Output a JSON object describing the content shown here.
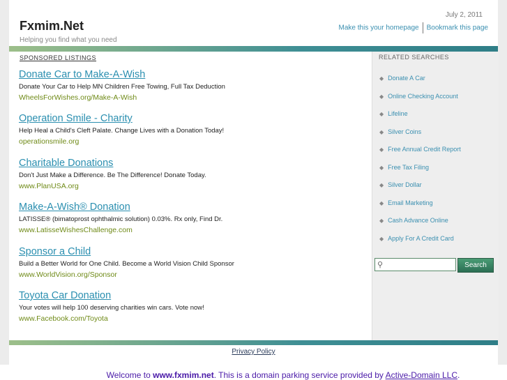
{
  "header": {
    "site_title": "Fxmim.Net",
    "tagline": "Helping you find what you need",
    "date": "July 2, 2011",
    "make_homepage": "Make this your homepage",
    "bookmark": "Bookmark this page"
  },
  "main": {
    "sponsored_label": "SPONSORED LISTINGS",
    "ads": [
      {
        "title": "Donate Car to Make-A-Wish",
        "desc": "Donate Your Car to Help MN Children Free Towing, Full Tax Deduction",
        "url": "WheelsForWishes.org/Make-A-Wish"
      },
      {
        "title": "Operation Smile - Charity",
        "desc": "Help Heal a Child's Cleft Palate. Change Lives with a Donation Today!",
        "url": "operationsmile.org"
      },
      {
        "title": "Charitable Donations",
        "desc": "Don't Just Make a Difference. Be The Difference! Donate Today.",
        "url": "www.PlanUSA.org"
      },
      {
        "title": "Make-A-Wish® Donation",
        "desc": "LATISSE® (bimatoprost ophthalmic solution) 0.03%. Rx only, Find Dr.",
        "url": "www.LatisseWishesChallenge.com"
      },
      {
        "title": "Sponsor a Child",
        "desc": "Build a Better World for One Child. Become a World Vision Child Sponsor",
        "url": "www.WorldVision.org/Sponsor"
      },
      {
        "title": "Toyota Car Donation",
        "desc": "Your votes will help 100 deserving charities win cars. Vote now!",
        "url": "www.Facebook.com/Toyota"
      }
    ]
  },
  "side": {
    "related_label": "RELATED SEARCHES",
    "items": [
      "Donate A Car",
      "Online Checking Account",
      "Lifeline",
      "Silver Coins",
      "Free Annual Credit Report",
      "Free Tax Filing",
      "Silver Dollar",
      "Email Marketing",
      "Cash Advance Online",
      "Apply For A Credit Card"
    ],
    "search_button": "Search",
    "search_placeholder": ""
  },
  "footer": {
    "privacy": "Privacy Policy",
    "welcome_prefix": "Welcome to ",
    "welcome_domain": "www.fxmim.net",
    "welcome_middle": ". This is a domain parking service provided by ",
    "welcome_provider": "Active-Domain LLC",
    "welcome_suffix": "."
  },
  "colors": {
    "accent": "#3a8fb0",
    "ad_url": "#6f8a17",
    "bar": "#3e8e94",
    "welcome": "#4a1aa8"
  }
}
